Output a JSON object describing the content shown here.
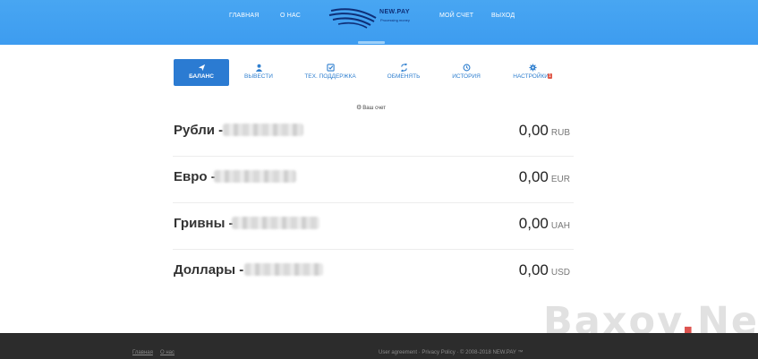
{
  "header": {
    "nav": [
      "ГЛАВНАЯ",
      "О НАС",
      "МОЙ СЧЕТ",
      "ВЫХОД"
    ],
    "logo_name": "NEW.PAY",
    "logo_tagline": "Processing money"
  },
  "tabs": [
    {
      "label": "БАЛАНС",
      "icon": "send-icon",
      "active": true
    },
    {
      "label": "ВЫВЕСТИ",
      "icon": "user-icon",
      "active": false
    },
    {
      "label": "ТЕХ. ПОДДЕРЖКА",
      "icon": "check-icon",
      "active": false
    },
    {
      "label": "ОБМЕНЯТЬ",
      "icon": "exchange-icon",
      "active": false
    },
    {
      "label": "ИСТОРИЯ",
      "icon": "clock-icon",
      "active": false
    },
    {
      "label": "НАСТРОЙКИ",
      "icon": "gear-icon",
      "active": false,
      "badge": "1"
    }
  ],
  "account": {
    "caption": "Ваш счет",
    "balances": [
      {
        "label": "Рубли -",
        "amount": "0,00",
        "currency": "RUB"
      },
      {
        "label": "Евро -",
        "amount": "0,00",
        "currency": "EUR"
      },
      {
        "label": "Гривны -",
        "amount": "0,00",
        "currency": "UAH"
      },
      {
        "label": "Доллары -",
        "amount": "0,00",
        "currency": "USD"
      }
    ]
  },
  "footer": {
    "links": [
      "Главная",
      "О нас"
    ],
    "legal": "User agreement · Privacy Policy · © 2008-2018 NEW.PAY ™"
  },
  "watermark": {
    "part1": "Baxov",
    "part2": ".",
    "part3": "Net"
  },
  "colors": {
    "header_bg": "#3d9cf0",
    "tab_active": "#2b7bd2",
    "footer_bg": "#2c2c2c",
    "watermark_dot": "#d4251f"
  }
}
